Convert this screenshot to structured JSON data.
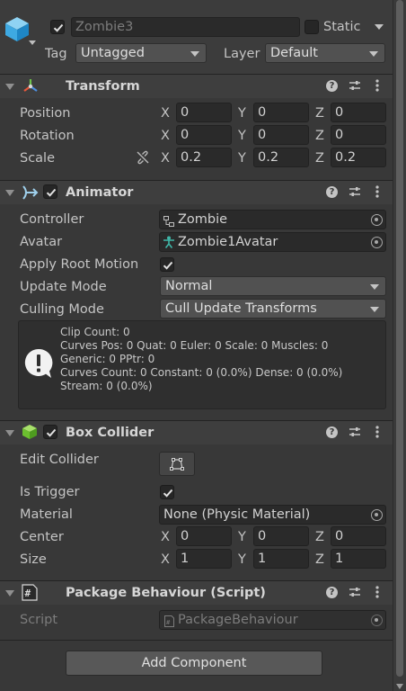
{
  "object": {
    "name": "Zombie3",
    "static_label": "Static",
    "tag_label": "Tag",
    "tag_value": "Untagged",
    "layer_label": "Layer",
    "layer_value": "Default"
  },
  "transform": {
    "title": "Transform",
    "position_label": "Position",
    "rotation_label": "Rotation",
    "scale_label": "Scale",
    "position": {
      "x": "0",
      "y": "0",
      "z": "0"
    },
    "rotation": {
      "x": "0",
      "y": "0",
      "z": "0"
    },
    "scale": {
      "x": "0.2",
      "y": "0.2",
      "z": "0.2"
    }
  },
  "axes": {
    "x": "X",
    "y": "Y",
    "z": "Z"
  },
  "animator": {
    "title": "Animator",
    "controller_label": "Controller",
    "controller_value": "Zombie",
    "avatar_label": "Avatar",
    "avatar_value": "Zombie1Avatar",
    "apply_root_motion_label": "Apply Root Motion",
    "update_mode_label": "Update Mode",
    "update_mode_value": "Normal",
    "culling_mode_label": "Culling Mode",
    "culling_mode_value": "Cull Update Transforms",
    "info_text": "Clip Count: 0\nCurves Pos: 0 Quat: 0 Euler: 0 Scale: 0 Muscles: 0\nGeneric: 0 PPtr: 0\nCurves Count: 0 Constant: 0 (0.0%) Dense: 0 (0.0%)\nStream: 0 (0.0%)"
  },
  "box_collider": {
    "title": "Box Collider",
    "edit_collider_label": "Edit Collider",
    "is_trigger_label": "Is Trigger",
    "material_label": "Material",
    "material_value": "None (Physic Material)",
    "center_label": "Center",
    "size_label": "Size",
    "center": {
      "x": "0",
      "y": "0",
      "z": "0"
    },
    "size": {
      "x": "1",
      "y": "1",
      "z": "1"
    }
  },
  "package_behaviour": {
    "title": "Package Behaviour (Script)",
    "script_label": "Script",
    "script_value": "PackageBehaviour"
  },
  "add_component_label": "Add Component",
  "colors": {
    "background": "#383838",
    "field": "#2a2a2a",
    "text": "#c4c4c4"
  }
}
